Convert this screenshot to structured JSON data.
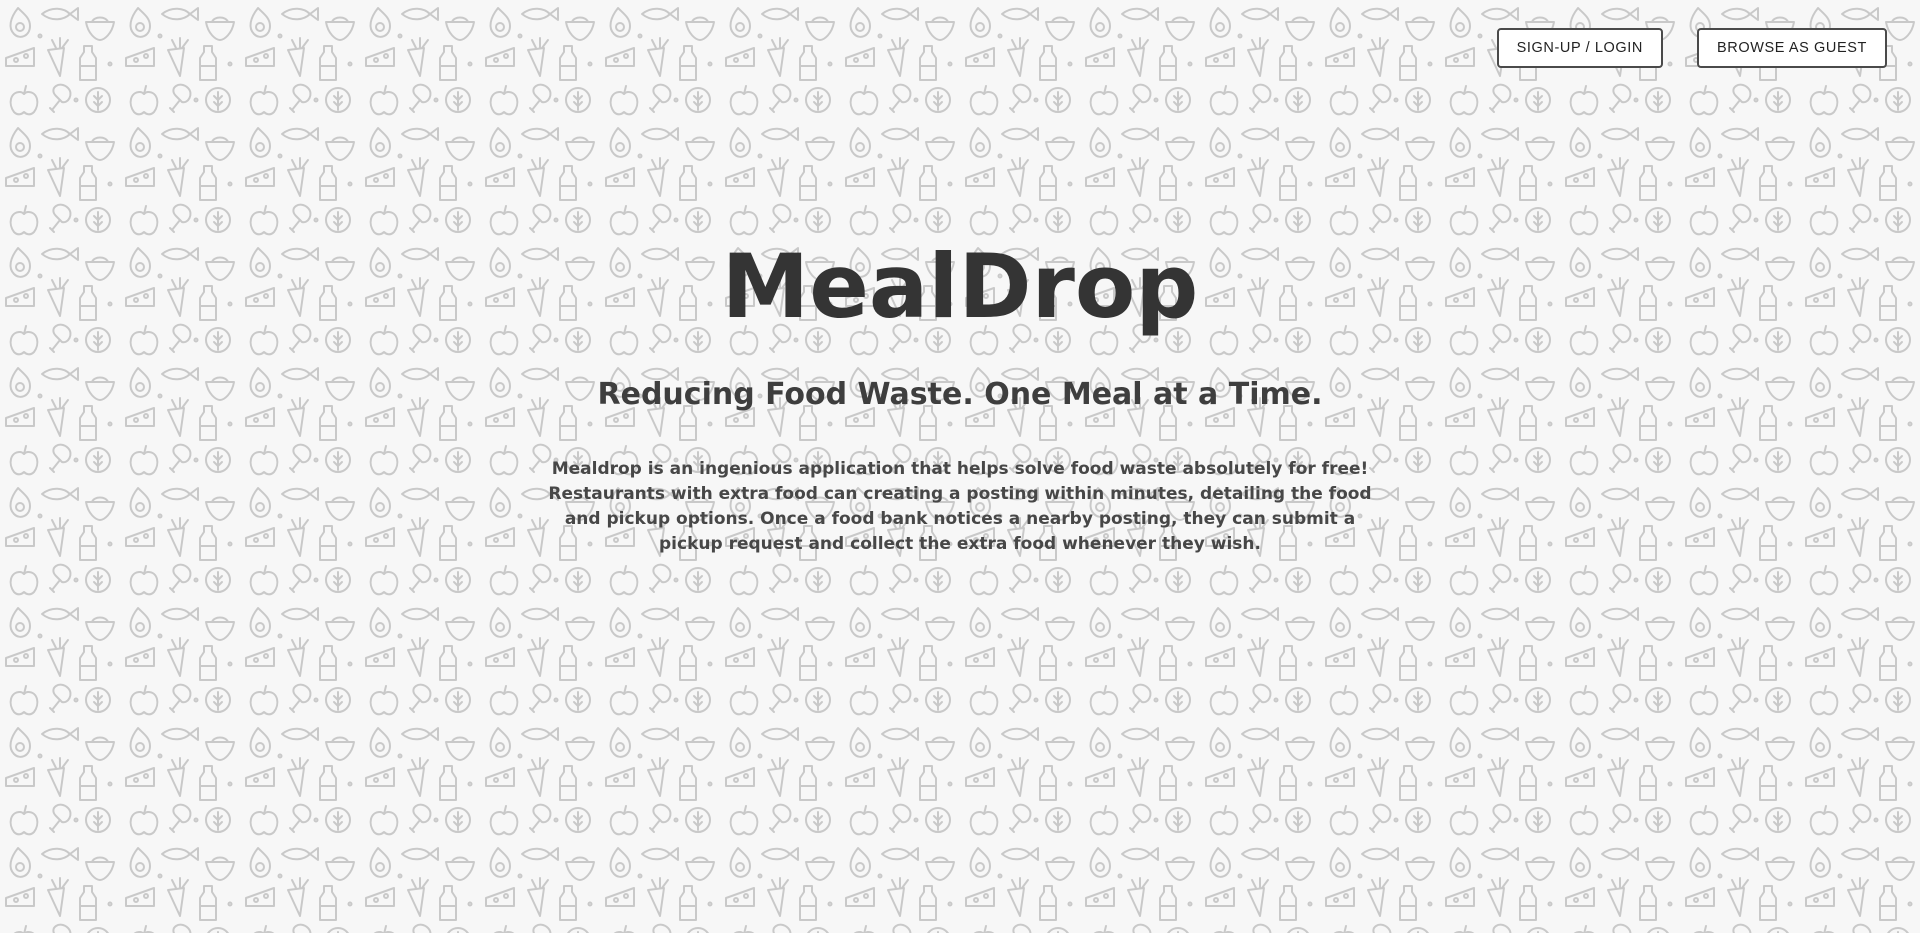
{
  "header": {
    "signup_login_label": "SIGN-UP / LOGIN",
    "browse_guest_label": "BROWSE AS GUEST"
  },
  "hero": {
    "title": "MealDrop",
    "tagline": "Reducing Food Waste. One Meal at a Time.",
    "description": "Mealdrop is an ingenious application that helps solve food waste absolutely for free! Restaurants with extra food can creating a posting within minutes, detailing the food and pickup options. Once a food bank notices a nearby posting, they can submit a pickup request and collect the extra food whenever they wish."
  },
  "background": {
    "pattern": "food-doodle-pattern",
    "icons": [
      "avocado-icon",
      "fish-icon",
      "bowl-icon",
      "cheese-icon",
      "carrot-icon",
      "bottle-icon",
      "apple-icon",
      "drumstick-icon",
      "grain-icon"
    ],
    "color": "#f7f7f7",
    "stroke_color": "#c9c9c9"
  },
  "colors": {
    "text_dark": "#343434",
    "button_border": "#4a4a4a"
  }
}
